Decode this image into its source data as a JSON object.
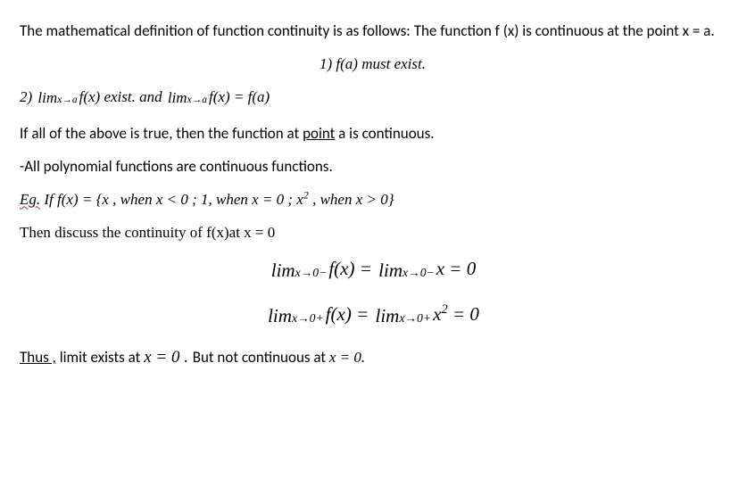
{
  "para1": "The mathematical definition of function continuity is as follows: The function f (x) is continuous at the point x = a.",
  "cond1": "1) f(a) must exist.",
  "cond2": {
    "prefix": "2) ",
    "lim1_top": "lim",
    "lim1_bot": "x→a",
    "after_lim1": "f(x) exist. and ",
    "lim2_top": "lim",
    "lim2_bot": "x→a",
    "after_lim2": "f(x)  =  f(a)"
  },
  "para3_a": "If all of the above is true, then the function at ",
  "para3_point": "point",
  "para3_b": " a is continuous.",
  "para4": "-All polynomial functions are continuous functions.",
  "eg": {
    "prefix": "Eg.",
    "body": " If  f(x) = {x , when x < 0   ;    1, when x = 0    ;    x",
    "sq": "2",
    "tail": " , when x > 0}"
  },
  "para6": "Then discuss the continuity of f(x)at x = 0",
  "eq1": {
    "lim1_top": "lim",
    "lim1_bot": "x→0−",
    "mid1": "f(x)  =  ",
    "lim2_top": "lim",
    "lim2_bot": "x→0−",
    "mid2": "x   =  0"
  },
  "eq2": {
    "lim1_top": "lim",
    "lim1_bot": "x→0+",
    "mid1": "f(x)  =  ",
    "lim2_top": "lim",
    "lim2_bot": "x→0+",
    "mid2a": "x",
    "sq": "2",
    "mid2b": "   =  0"
  },
  "final": {
    "thus": "Thus ,",
    "a": " limit exists at ",
    "x": "x  ",
    "eq0": "=  0 . ",
    "b": "But not continuous at ",
    "xeq": "x  =  0."
  }
}
